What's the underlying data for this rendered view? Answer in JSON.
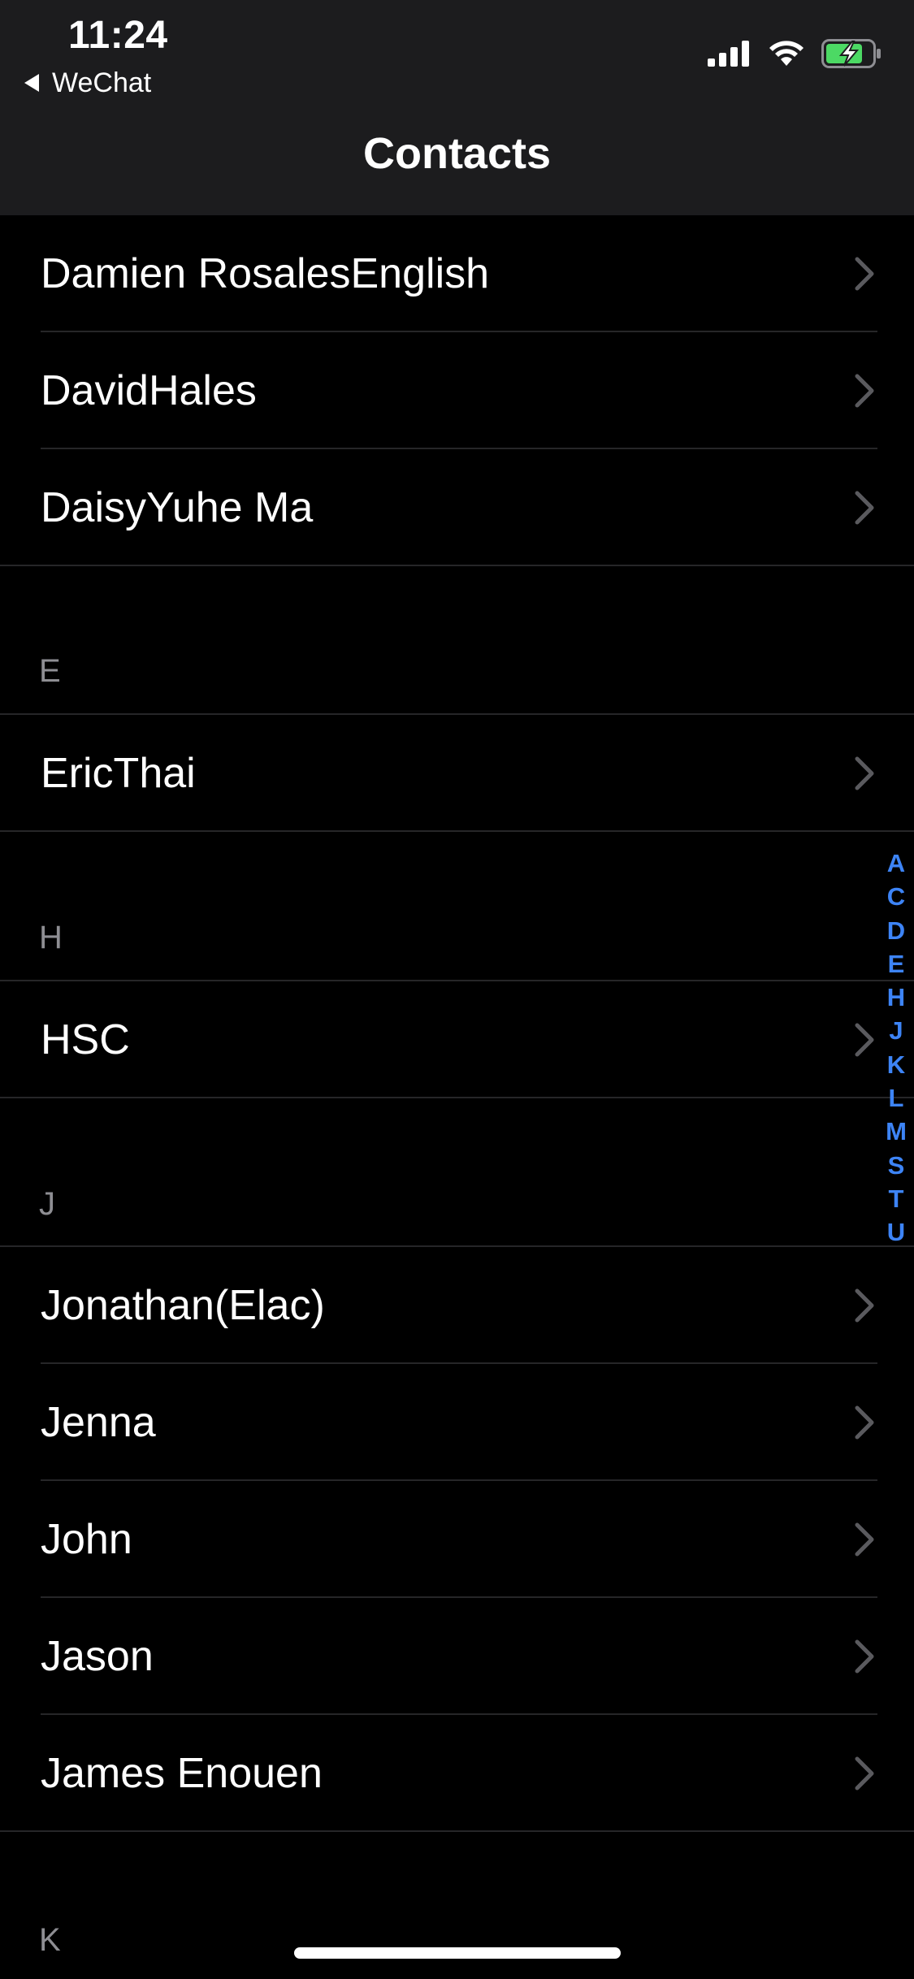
{
  "status_bar": {
    "time": "11:24",
    "back_app": "WeChat",
    "icons": [
      "cellular-signal-icon",
      "wifi-icon",
      "battery-charging-icon"
    ],
    "battery_color": "#4cd964"
  },
  "nav": {
    "title": "Contacts"
  },
  "colors": {
    "accent": "#3d84f6",
    "background": "#000000",
    "bar": "#1c1c1e"
  },
  "contacts_d": [
    {
      "name": "Damien RosalesEnglish"
    },
    {
      "name": "DavidHales"
    },
    {
      "name": "DaisyYuhe Ma"
    }
  ],
  "section_e": {
    "letter": "E",
    "contacts": [
      {
        "name": "EricThai"
      }
    ]
  },
  "section_h": {
    "letter": "H",
    "contacts": [
      {
        "name": "HSC"
      }
    ]
  },
  "section_j": {
    "letter": "J",
    "contacts": [
      {
        "name": "Jonathan(Elac)"
      },
      {
        "name": "Jenna"
      },
      {
        "name": "John"
      },
      {
        "name": "Jason"
      },
      {
        "name": "James Enouen"
      }
    ]
  },
  "section_k": {
    "letter": "K"
  },
  "index_letters": [
    "A",
    "C",
    "D",
    "E",
    "H",
    "J",
    "K",
    "L",
    "M",
    "S",
    "T",
    "U"
  ]
}
